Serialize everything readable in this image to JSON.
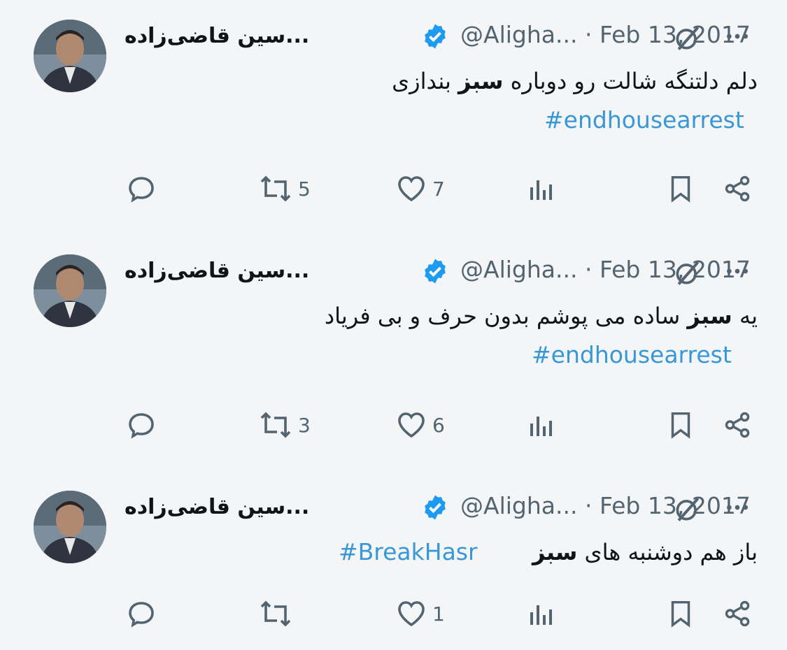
{
  "tweets": [
    {
      "name": "...سین قاضی‌زاده",
      "handle": "@Aligha...",
      "date": "Feb 13, 2017",
      "text_before": "دلم دلتنگه شالت رو دوباره ",
      "text_bold": "سبز",
      "text_after": " بندازی",
      "hashtag": "#endhousearrest",
      "replies": "",
      "retweets": "5",
      "likes": "7"
    },
    {
      "name": "...سین قاضی‌زاده",
      "handle": "@Aligha...",
      "date": "Feb 13, 2017",
      "text_before": "یه ",
      "text_bold": "سبز",
      "text_after": " ساده می پوشم بدون حرف و بی فریاد",
      "hashtag": "#endhousearrest",
      "replies": "",
      "retweets": "3",
      "likes": "6"
    },
    {
      "name": "...سین قاضی‌زاده",
      "handle": "@Aligha...",
      "date": "Feb 13, 2017",
      "text_before": "باز هم دوشنبه های ",
      "text_bold": "سبز",
      "text_after": "",
      "hashtag": "#BreakHasr",
      "replies": "",
      "retweets": "",
      "likes": "1"
    }
  ],
  "colors": {
    "accent": "#1d9bf0",
    "hashtag": "#3897d6",
    "muted": "#536471"
  },
  "icons": [
    "verified-badge-icon",
    "grok-icon",
    "more-icon",
    "reply-icon",
    "retweet-icon",
    "like-icon",
    "views-icon",
    "bookmark-icon",
    "share-icon"
  ]
}
